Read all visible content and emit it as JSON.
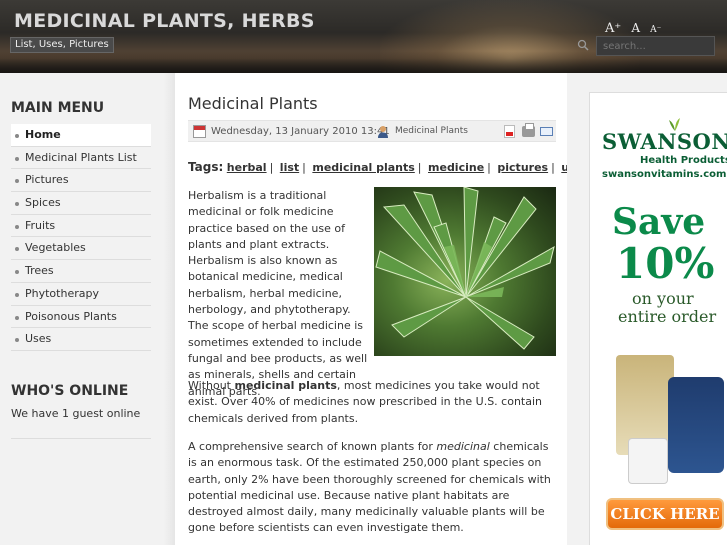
{
  "header": {
    "site_title": "MEDICINAL PLANTS, HERBS",
    "tagline": "List, Uses, Pictures",
    "font_sizer": {
      "increase": "A⁺",
      "reset": "A",
      "decrease": "A⁻"
    },
    "search_placeholder": "search..."
  },
  "sidebar": {
    "main_menu_title": "MAIN MENU",
    "items": [
      {
        "label": "Home",
        "active": true
      },
      {
        "label": "Medicinal Plants List"
      },
      {
        "label": "Pictures"
      },
      {
        "label": "Spices"
      },
      {
        "label": "Fruits"
      },
      {
        "label": "Vegetables"
      },
      {
        "label": "Trees"
      },
      {
        "label": "Phytotherapy"
      },
      {
        "label": "Poisonous Plants"
      },
      {
        "label": "Uses"
      }
    ],
    "whos_online_title": "WHO'S ONLINE",
    "whos_online_text": "We have 1 guest online"
  },
  "article": {
    "title": "Medicinal Plants",
    "date": "Wednesday, 13 January 2010 13:41",
    "category": "Medicinal Plants",
    "tags_label": "Tags:",
    "tags": [
      "herbal",
      "list",
      "medicinal plants",
      "medicine",
      "pictures",
      "uses"
    ],
    "para1": "Herbalism is a traditional medicinal or folk medicine practice based on the use of plants and plant extracts. Herbalism is also known as botanical medicine, medical herbalism, herbal medicine, herbology, and phytotherapy. The scope of herbal medicine is sometimes extended to include fungal and bee products, as well as minerals, shells and certain animal parts.",
    "para2_before": "Without ",
    "para2_bold": "medicinal plants",
    "para2_after": ", most medicines you take would not exist. Over 40% of medicines now prescribed in the U.S. contain chemicals derived from plants.",
    "para3_before": "A comprehensive search of known plants for ",
    "para3_italic": "medicinal",
    "para3_after": " chemicals is an enormous task. Of the estimated 250,000 plant species on earth, only 2% have been thoroughly screened for chemicals with potential medicinal use. Because native plant habitats are destroyed almost daily, many medicinally valuable plants will be gone before scientists can even investigate them."
  },
  "ad": {
    "brand": "SWANSON",
    "sub": "Health Products",
    "url": "swansonvitamins.com",
    "save": "Save",
    "percent": "10%",
    "line1": "on your",
    "line2": "entire order",
    "button": "CLICK HERE"
  },
  "colors": {
    "ad_green": "#0b8a4a",
    "ad_button": "#e46a0a"
  }
}
